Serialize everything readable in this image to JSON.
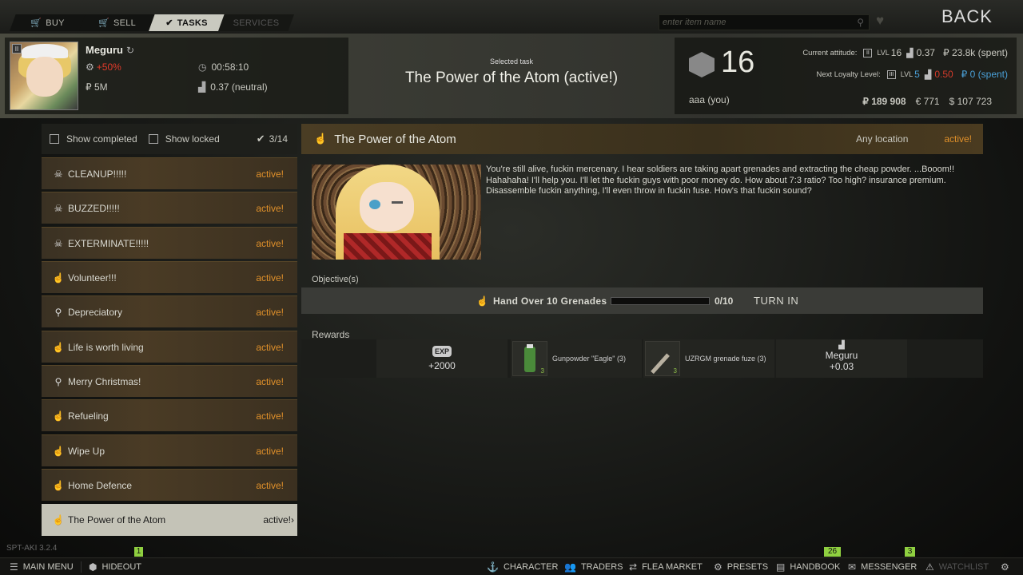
{
  "topbar": {
    "tabs": [
      {
        "label": "BUY",
        "icon": "cart-icon"
      },
      {
        "label": "SELL",
        "icon": "cart-icon"
      },
      {
        "label": "TASKS",
        "icon": "checkmark-icon"
      },
      {
        "label": "SERVICES",
        "icon": ""
      }
    ],
    "search_placeholder": "enter item name",
    "back_label": "BACK"
  },
  "trader": {
    "name": "Meguru",
    "rank_roman": "II",
    "discount": "+50%",
    "timer": "00:58:10",
    "money": "₽ 5M",
    "reputation": "0.37 (neutral)"
  },
  "selected_task": {
    "label": "Selected task",
    "title": "The Power of the Atom (active!)"
  },
  "player": {
    "level": "16",
    "name": "aaa (you)",
    "current_attitude": {
      "label": "Current attitude:",
      "rank": "II",
      "lvl_prefix": "LVL",
      "lvl": "16",
      "standing": "0.37",
      "spent": "₽ 23.8k (spent)"
    },
    "next_loyalty": {
      "label": "Next Loyalty Level:",
      "rank": "III",
      "lvl_prefix": "LVL",
      "lvl": "5",
      "standing": "0.50",
      "spent": "₽ 0 (spent)"
    },
    "balances": {
      "rub": "₽ 189 908",
      "eur": "€ 771",
      "usd": "$ 107 723"
    }
  },
  "task_list": {
    "show_completed": "Show completed",
    "show_locked": "Show locked",
    "count": "3/14",
    "items": [
      {
        "name": "CLEANUP!!!!!",
        "status": "active!",
        "icon": "skull-icon"
      },
      {
        "name": "BUZZED!!!!!",
        "status": "active!",
        "icon": "skull-icon"
      },
      {
        "name": "EXTERMINATE!!!!!",
        "status": "active!",
        "icon": "skull-icon"
      },
      {
        "name": "Volunteer!!!",
        "status": "active!",
        "icon": "hand-icon"
      },
      {
        "name": "Depreciatory",
        "status": "active!",
        "icon": "search-person-icon"
      },
      {
        "name": "Life is worth living",
        "status": "active!",
        "icon": "hand-icon"
      },
      {
        "name": "Merry Christmas!",
        "status": "active!",
        "icon": "search-person-icon"
      },
      {
        "name": "Refueling",
        "status": "active!",
        "icon": "hand-icon"
      },
      {
        "name": "Wipe Up",
        "status": "active!",
        "icon": "hand-icon"
      },
      {
        "name": "Home Defence",
        "status": "active!",
        "icon": "hand-icon"
      },
      {
        "name": "The Power of the Atom",
        "status": "active!",
        "icon": "hand-icon"
      }
    ]
  },
  "detail": {
    "title": "The Power of the Atom",
    "location": "Any location",
    "status": "active!",
    "description": "You're still alive, fuckin mercenary. I hear soldiers are taking apart grenades and extracting the cheap powder. ...Booom!! Hahahaha! I'll help you. I'll let the fuckin guys with poor money do. How about 7:3 ratio? Too high? insurance premium. Disassemble fuckin anything, I'll even throw in fuckin fuse. How's that fuckin sound?",
    "objectives_label": "Objective(s)",
    "objective": {
      "text": "Hand Over 10 Grenades",
      "progress_text": "0/10",
      "progress": 0,
      "action": "TURN IN"
    },
    "rewards_label": "Rewards",
    "rewards": {
      "exp_badge": "EXP",
      "exp": "+2000",
      "items": [
        {
          "name": "Gunpowder \"Eagle\" (3)",
          "qty": "3",
          "icon": "gunpowder-icon"
        },
        {
          "name": "UZRGM grenade fuze (3)",
          "qty": "3",
          "icon": "fuze-icon"
        }
      ],
      "rep_name": "Meguru",
      "rep_value": "+0.03"
    }
  },
  "bottombar": {
    "version": "SPT-AKI 3.2.4",
    "items": [
      {
        "label": "MAIN MENU",
        "icon": "menu-icon"
      },
      {
        "label": "HIDEOUT",
        "icon": "hideout-icon",
        "badge": "1"
      },
      {
        "label": "CHARACTER",
        "icon": "character-icon"
      },
      {
        "label": "TRADERS",
        "icon": "traders-icon"
      },
      {
        "label": "FLEA MARKET",
        "icon": "flea-market-icon"
      },
      {
        "label": "PRESETS",
        "icon": "presets-icon"
      },
      {
        "label": "HANDBOOK",
        "icon": "handbook-icon",
        "badge": "26"
      },
      {
        "label": "MESSENGER",
        "icon": "messenger-icon",
        "badge": "3"
      },
      {
        "label": "WATCHLIST",
        "icon": "warning-icon"
      },
      {
        "label": "",
        "icon": "gear-icon"
      }
    ]
  },
  "colors": {
    "accent_orange": "#e0902a",
    "discount_red": "#d03a2a",
    "loyalty_blue": "#4aa0d8",
    "badge_green": "#8fd040"
  }
}
